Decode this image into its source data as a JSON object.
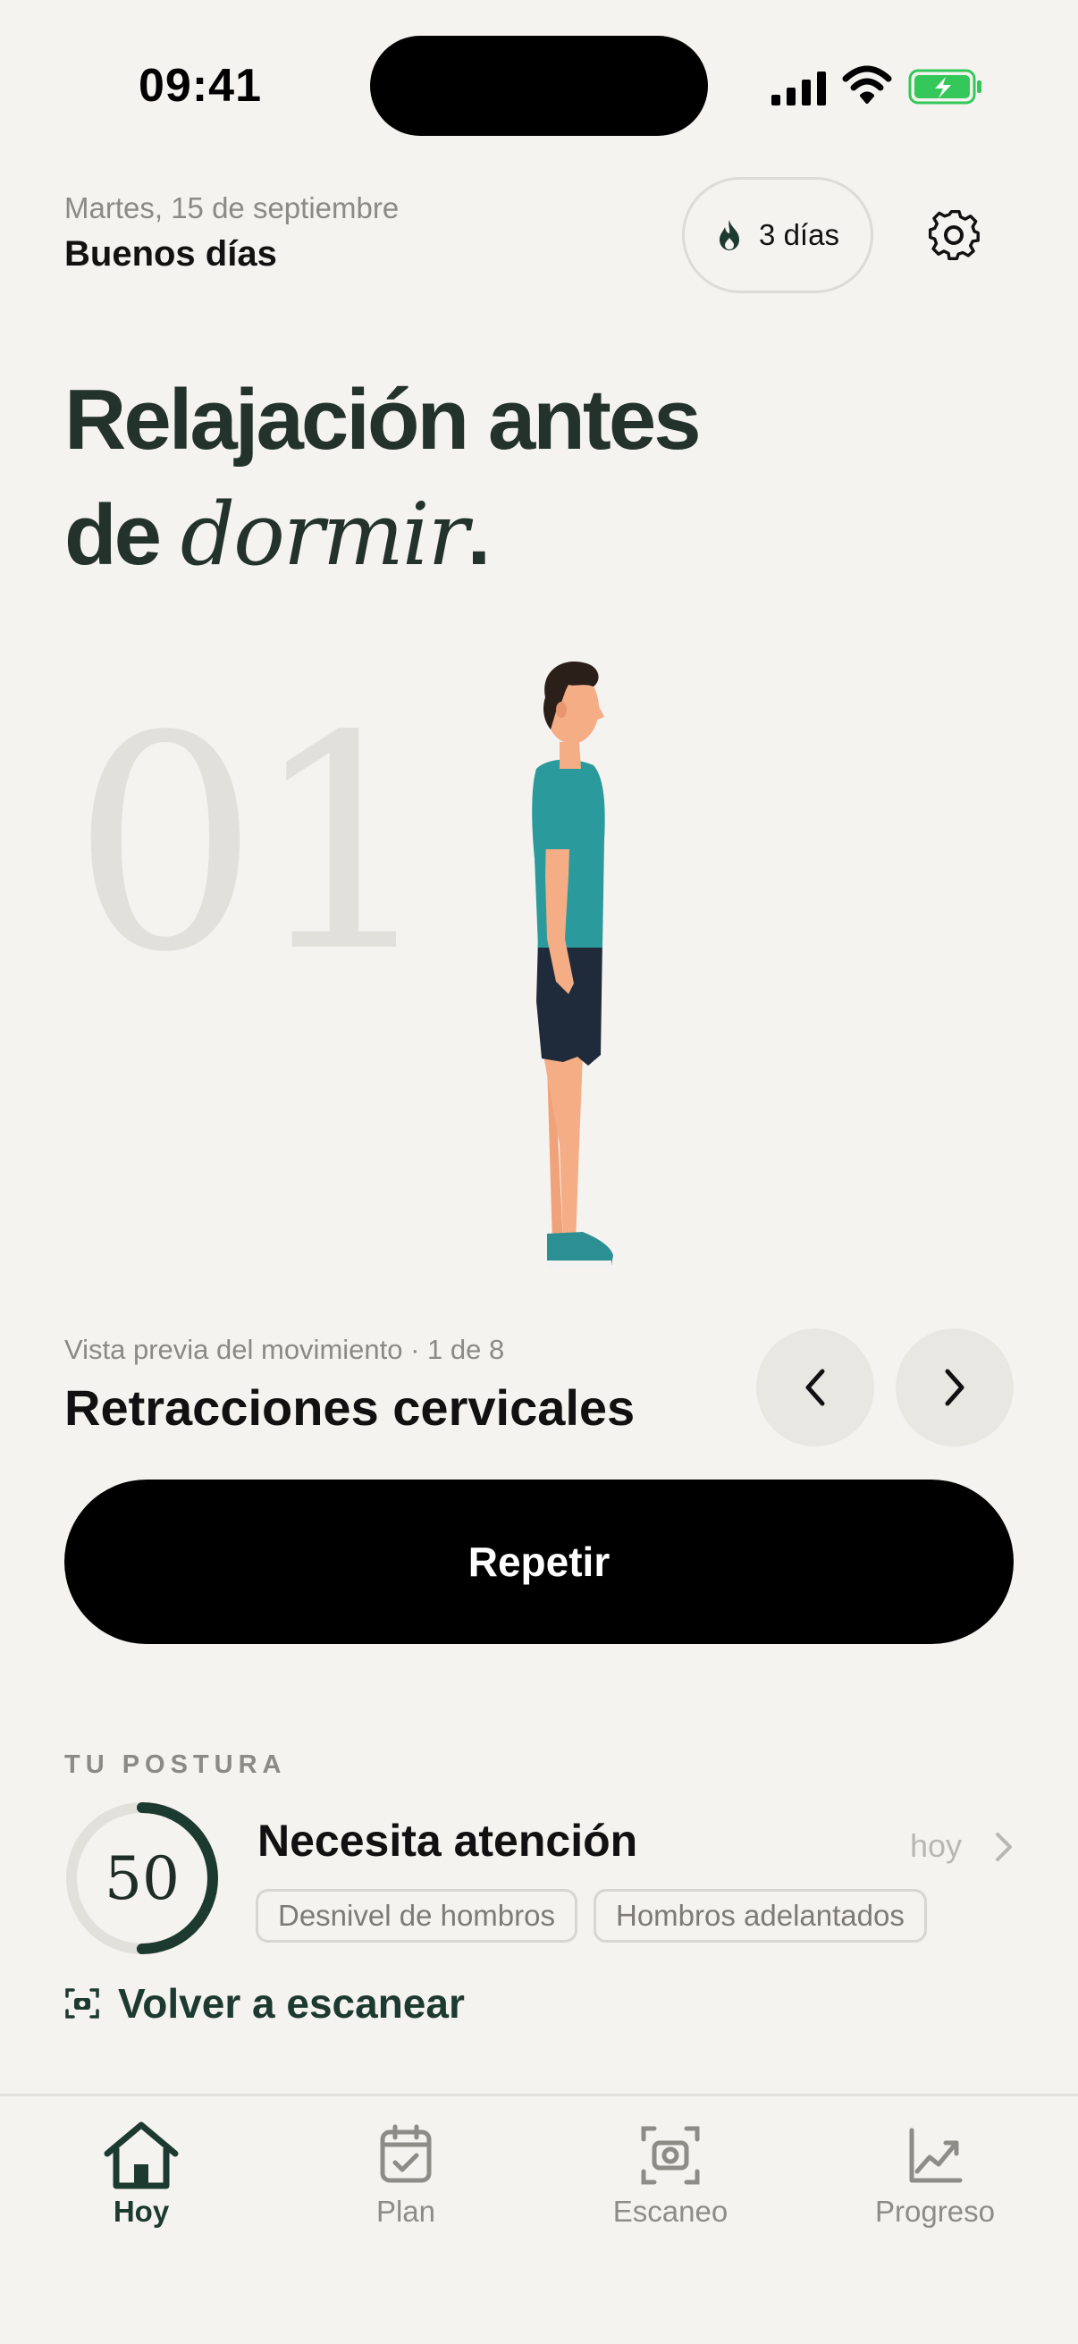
{
  "status_bar": {
    "time": "09:41"
  },
  "header": {
    "date": "Martes, 15 de septiembre",
    "greeting": "Buenos días",
    "streak_label": "3 días"
  },
  "hero": {
    "title_line1": "Relajación antes",
    "title_line2_prefix": "de ",
    "title_line2_italic": "dormir",
    "title_line2_suffix": ".",
    "step_number": "01"
  },
  "preview": {
    "meta": "Vista previa del movimiento · 1 de 8",
    "exercise_name": "Retracciones cervicales",
    "repeat_label": "Repetir"
  },
  "posture": {
    "section_label": "TU POSTURA",
    "score": "50",
    "score_fraction": 0.5,
    "status": "Necesita atención",
    "date": "hoy",
    "tags": [
      "Desnivel de hombros",
      "Hombros adelantados"
    ],
    "rescan_label": "Volver a escanear"
  },
  "tab_bar": {
    "home": "Hoy",
    "plan": "Plan",
    "scan": "Escaneo",
    "progress": "Progreso"
  },
  "colors": {
    "background": "#f5f3ef",
    "accent_dark_green": "#1d3a30",
    "title": "#23332c",
    "battery_green": "#34c759",
    "figure_shirt": "#2a9a9c",
    "figure_shorts": "#1f2a3a"
  },
  "icons": [
    "signal-icon",
    "wifi-icon",
    "battery-charging-icon",
    "flame-icon",
    "gear-icon",
    "chevron-left-icon",
    "chevron-right-icon",
    "scan-icon",
    "home-icon",
    "calendar-check-icon",
    "camera-scan-icon",
    "chart-trend-icon"
  ]
}
